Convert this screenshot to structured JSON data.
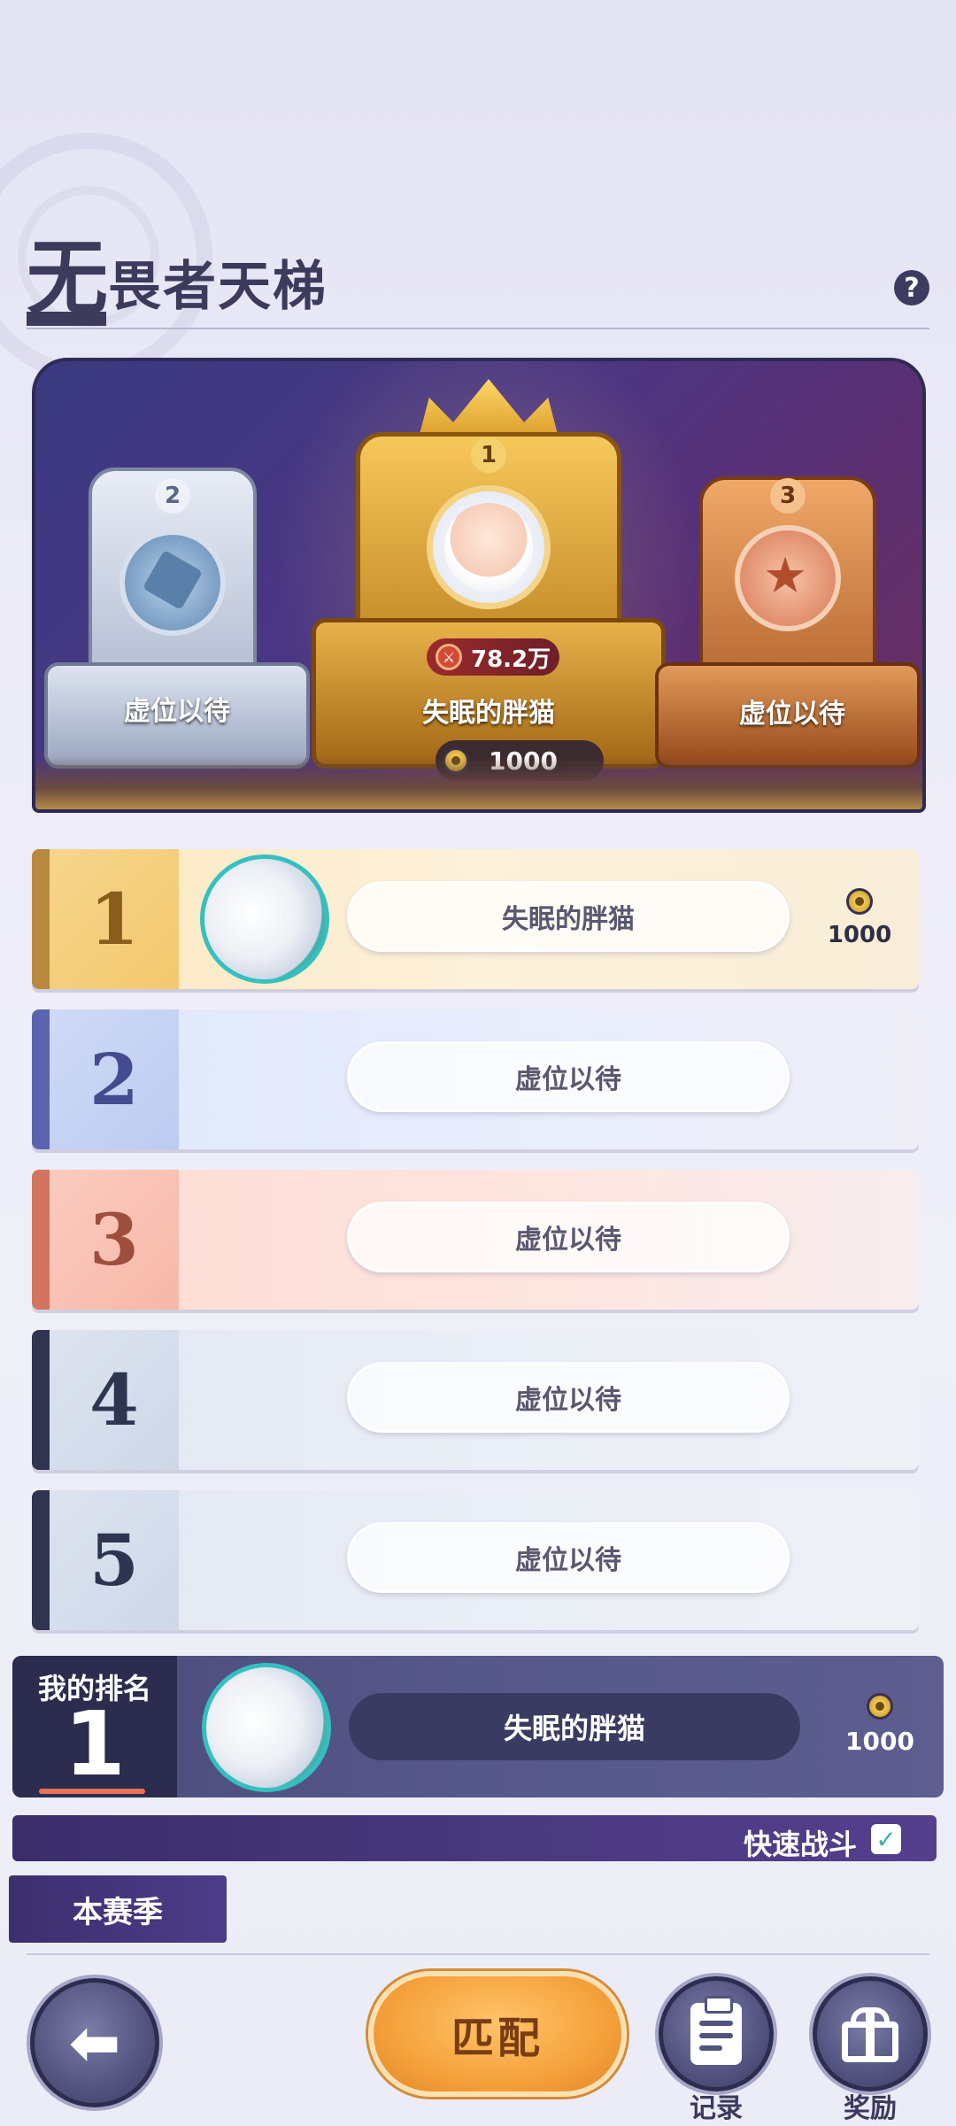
{
  "header": {
    "title_first": "无",
    "title_rest": "畏者天梯",
    "help_icon": "question-icon"
  },
  "podium": {
    "first": {
      "rank": "1",
      "power": "78.2万",
      "name": "失眠的胖猫",
      "coins": "1000"
    },
    "second": {
      "rank": "2",
      "label": "虚位以待"
    },
    "third": {
      "rank": "3",
      "label": "虚位以待"
    }
  },
  "ranks": [
    {
      "rank": "1",
      "name": "失眠的胖猫",
      "coins": "1000"
    },
    {
      "rank": "2",
      "name": "虚位以待"
    },
    {
      "rank": "3",
      "name": "虚位以待"
    },
    {
      "rank": "4",
      "name": "虚位以待"
    },
    {
      "rank": "5",
      "name": "虚位以待"
    }
  ],
  "my_rank": {
    "label": "我的排名",
    "rank": "1",
    "name": "失眠的胖猫",
    "coins": "1000"
  },
  "quick_battle": {
    "label": "快速战斗",
    "checked": true,
    "check_mark": "✓"
  },
  "season_tab": "本赛季",
  "buttons": {
    "back": "back-arrow-icon",
    "match": "匹配",
    "record": "记录",
    "reward": "奖励"
  },
  "colors": {
    "accent_dark": "#3c3b5c",
    "gold": "#f3c86e",
    "match_orange": "#f5a23c",
    "check_teal": "#36b6a8"
  }
}
